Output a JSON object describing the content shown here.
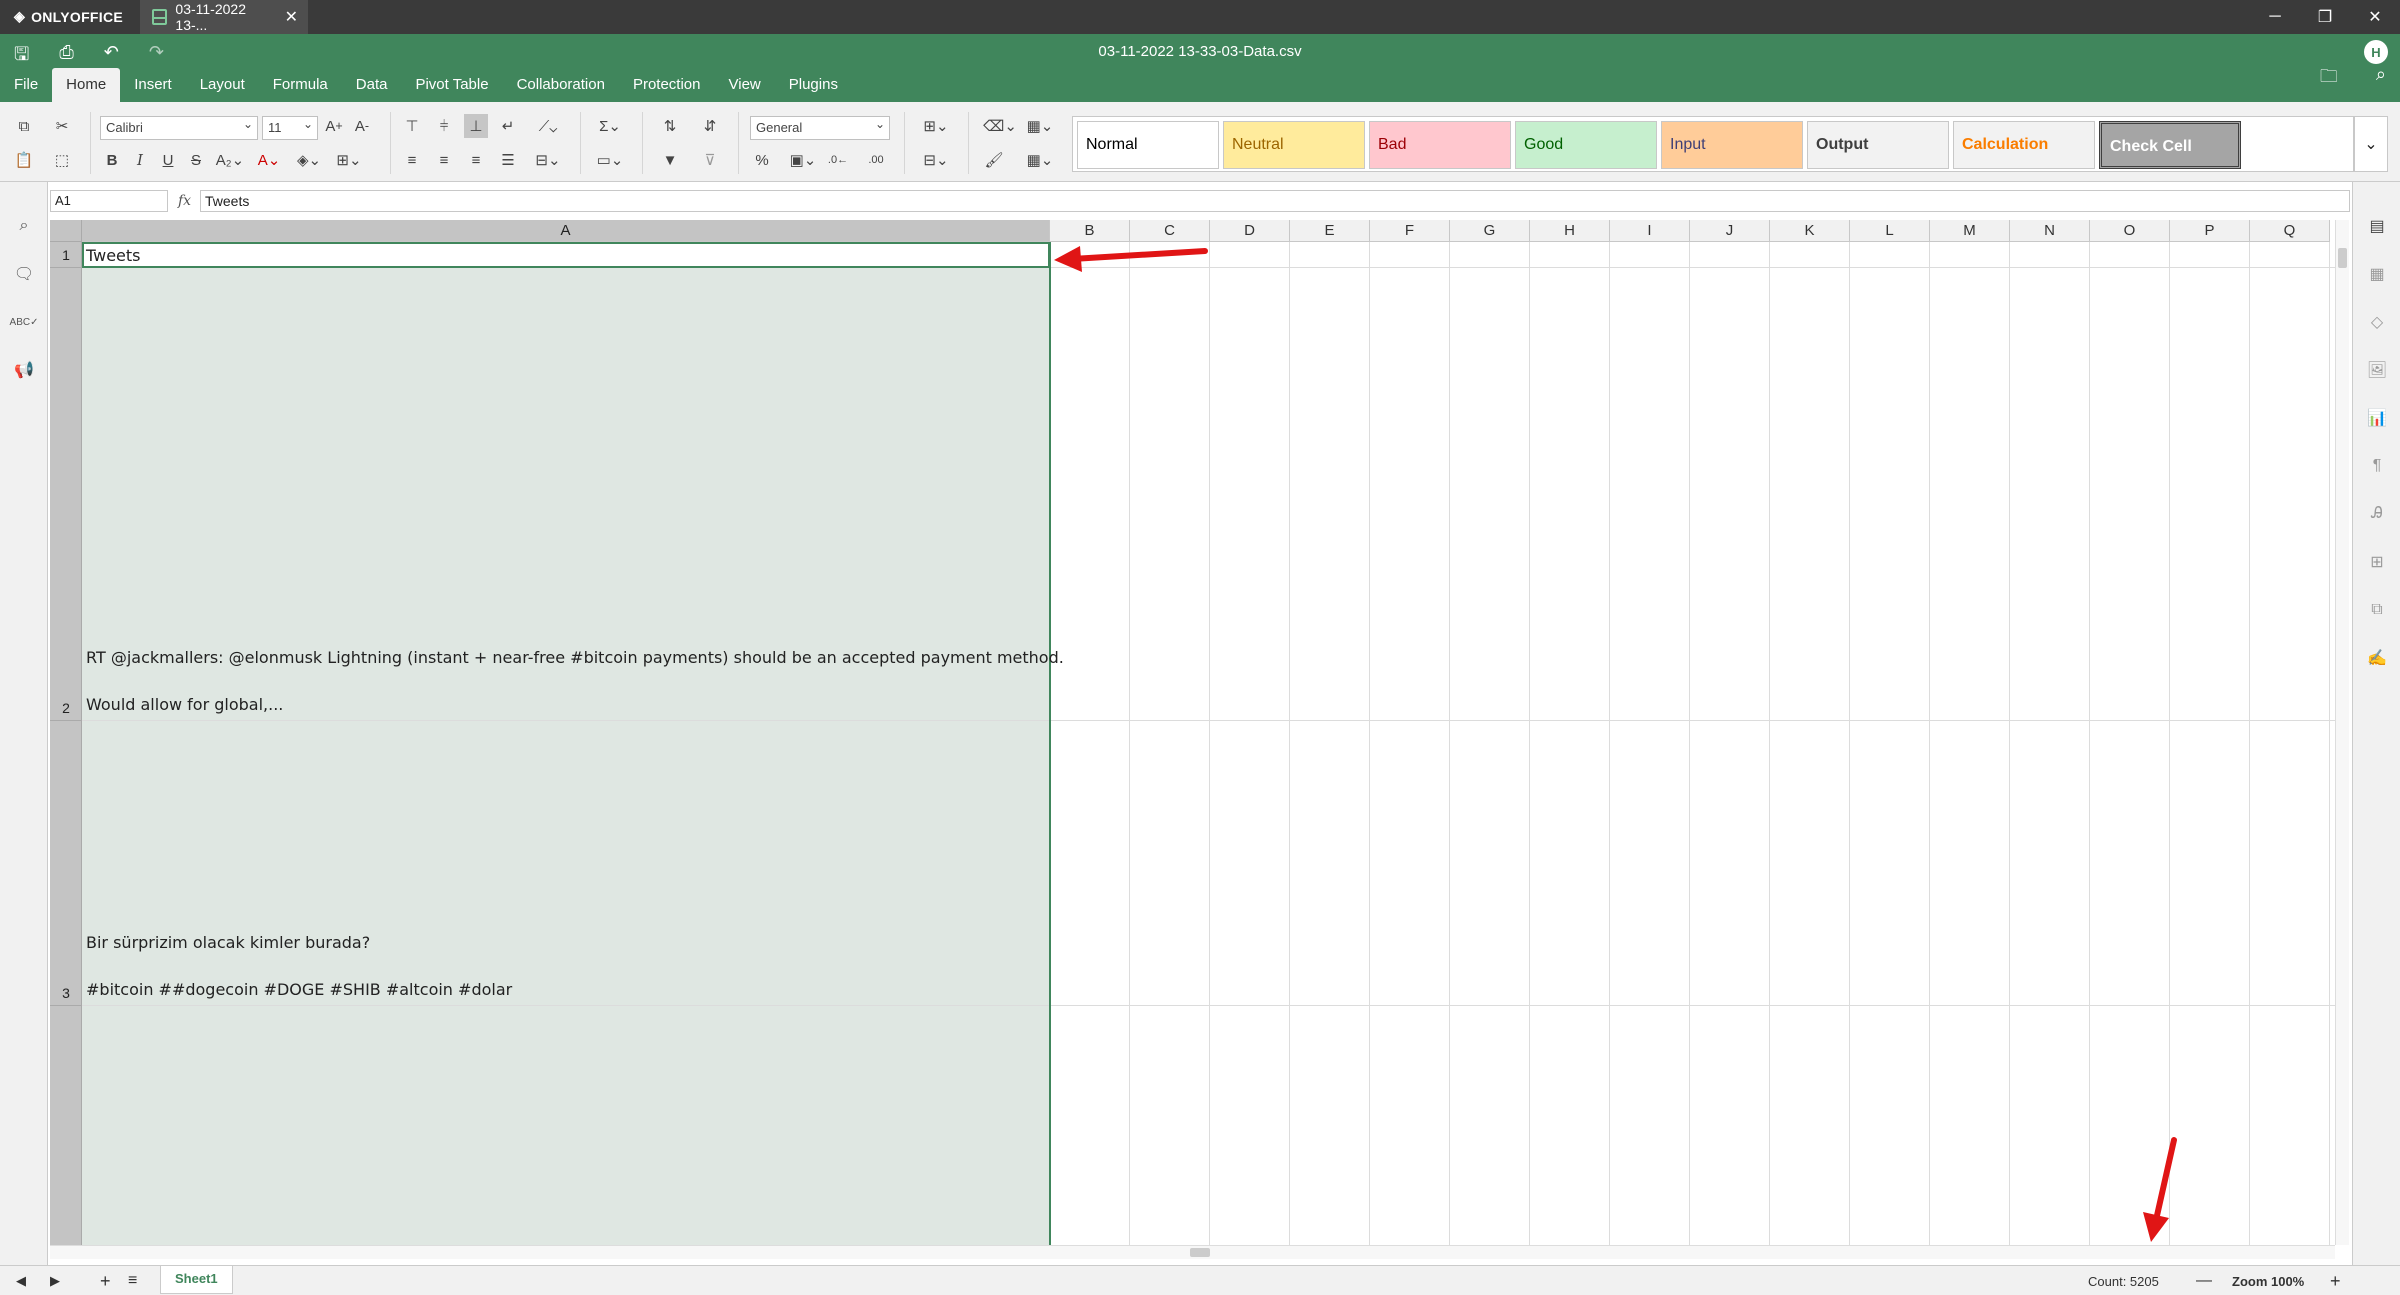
{
  "app": {
    "name": "ONLYOFFICE",
    "tab_title": "03-11-2022 13-...",
    "doc_title": "03-11-2022 13-33-03-Data.csv",
    "user_initial": "H"
  },
  "window": {
    "minimize": "─",
    "restore": "❐",
    "close": "✕"
  },
  "menu": [
    "File",
    "Home",
    "Insert",
    "Layout",
    "Formula",
    "Data",
    "Pivot Table",
    "Collaboration",
    "Protection",
    "View",
    "Plugins"
  ],
  "toolbar": {
    "font_name": "Calibri",
    "font_size": "11",
    "number_format": "General"
  },
  "cell_styles": [
    {
      "label": "Normal",
      "bg": "#ffffff",
      "fg": "#000000",
      "bold": false
    },
    {
      "label": "Neutral",
      "bg": "#ffeb9c",
      "fg": "#9c6500",
      "bold": false
    },
    {
      "label": "Bad",
      "bg": "#ffc7ce",
      "fg": "#9c0006",
      "bold": false
    },
    {
      "label": "Good",
      "bg": "#c6efce",
      "fg": "#006100",
      "bold": false
    },
    {
      "label": "Input",
      "bg": "#ffcc99",
      "fg": "#3f3f76",
      "bold": false
    },
    {
      "label": "Output",
      "bg": "#f2f2f2",
      "fg": "#3f3f3f",
      "bold": true
    },
    {
      "label": "Calculation",
      "bg": "#f2f2f2",
      "fg": "#fa7d00",
      "bold": true
    },
    {
      "label": "Check Cell",
      "bg": "#a5a5a5",
      "fg": "#ffffff",
      "bold": true
    }
  ],
  "formula_bar": {
    "cell_ref": "A1",
    "fx": "fx",
    "value": "Tweets"
  },
  "columns": [
    "A",
    "B",
    "C",
    "D",
    "E",
    "F",
    "G",
    "H",
    "I",
    "J",
    "K",
    "L",
    "M",
    "N",
    "O",
    "P",
    "Q"
  ],
  "rows": [
    {
      "num": "1",
      "lines": [
        "Tweets"
      ]
    },
    {
      "num": "2",
      "lines": [
        "RT @jackmallers: @elonmusk Lightning (instant + near-free #bitcoin payments) should be an accepted payment method.",
        "Would allow for global,..."
      ]
    },
    {
      "num": "3",
      "lines": [
        "Bir sürprizim olacak kimler burada?",
        "#bitcoin ##dogecoin #DOGE #SHIB #altcoin #dolar"
      ]
    }
  ],
  "status": {
    "sheet_tab": "Sheet1",
    "count": "Count: 5205",
    "zoom": "Zoom 100%"
  },
  "icons": {
    "save": "🖫",
    "print": "⎙",
    "undo": "↶",
    "redo": "↷",
    "search": "⌕",
    "comment": "▭",
    "spell": "ᴬᴮᶜ",
    "feedback": "📢"
  }
}
